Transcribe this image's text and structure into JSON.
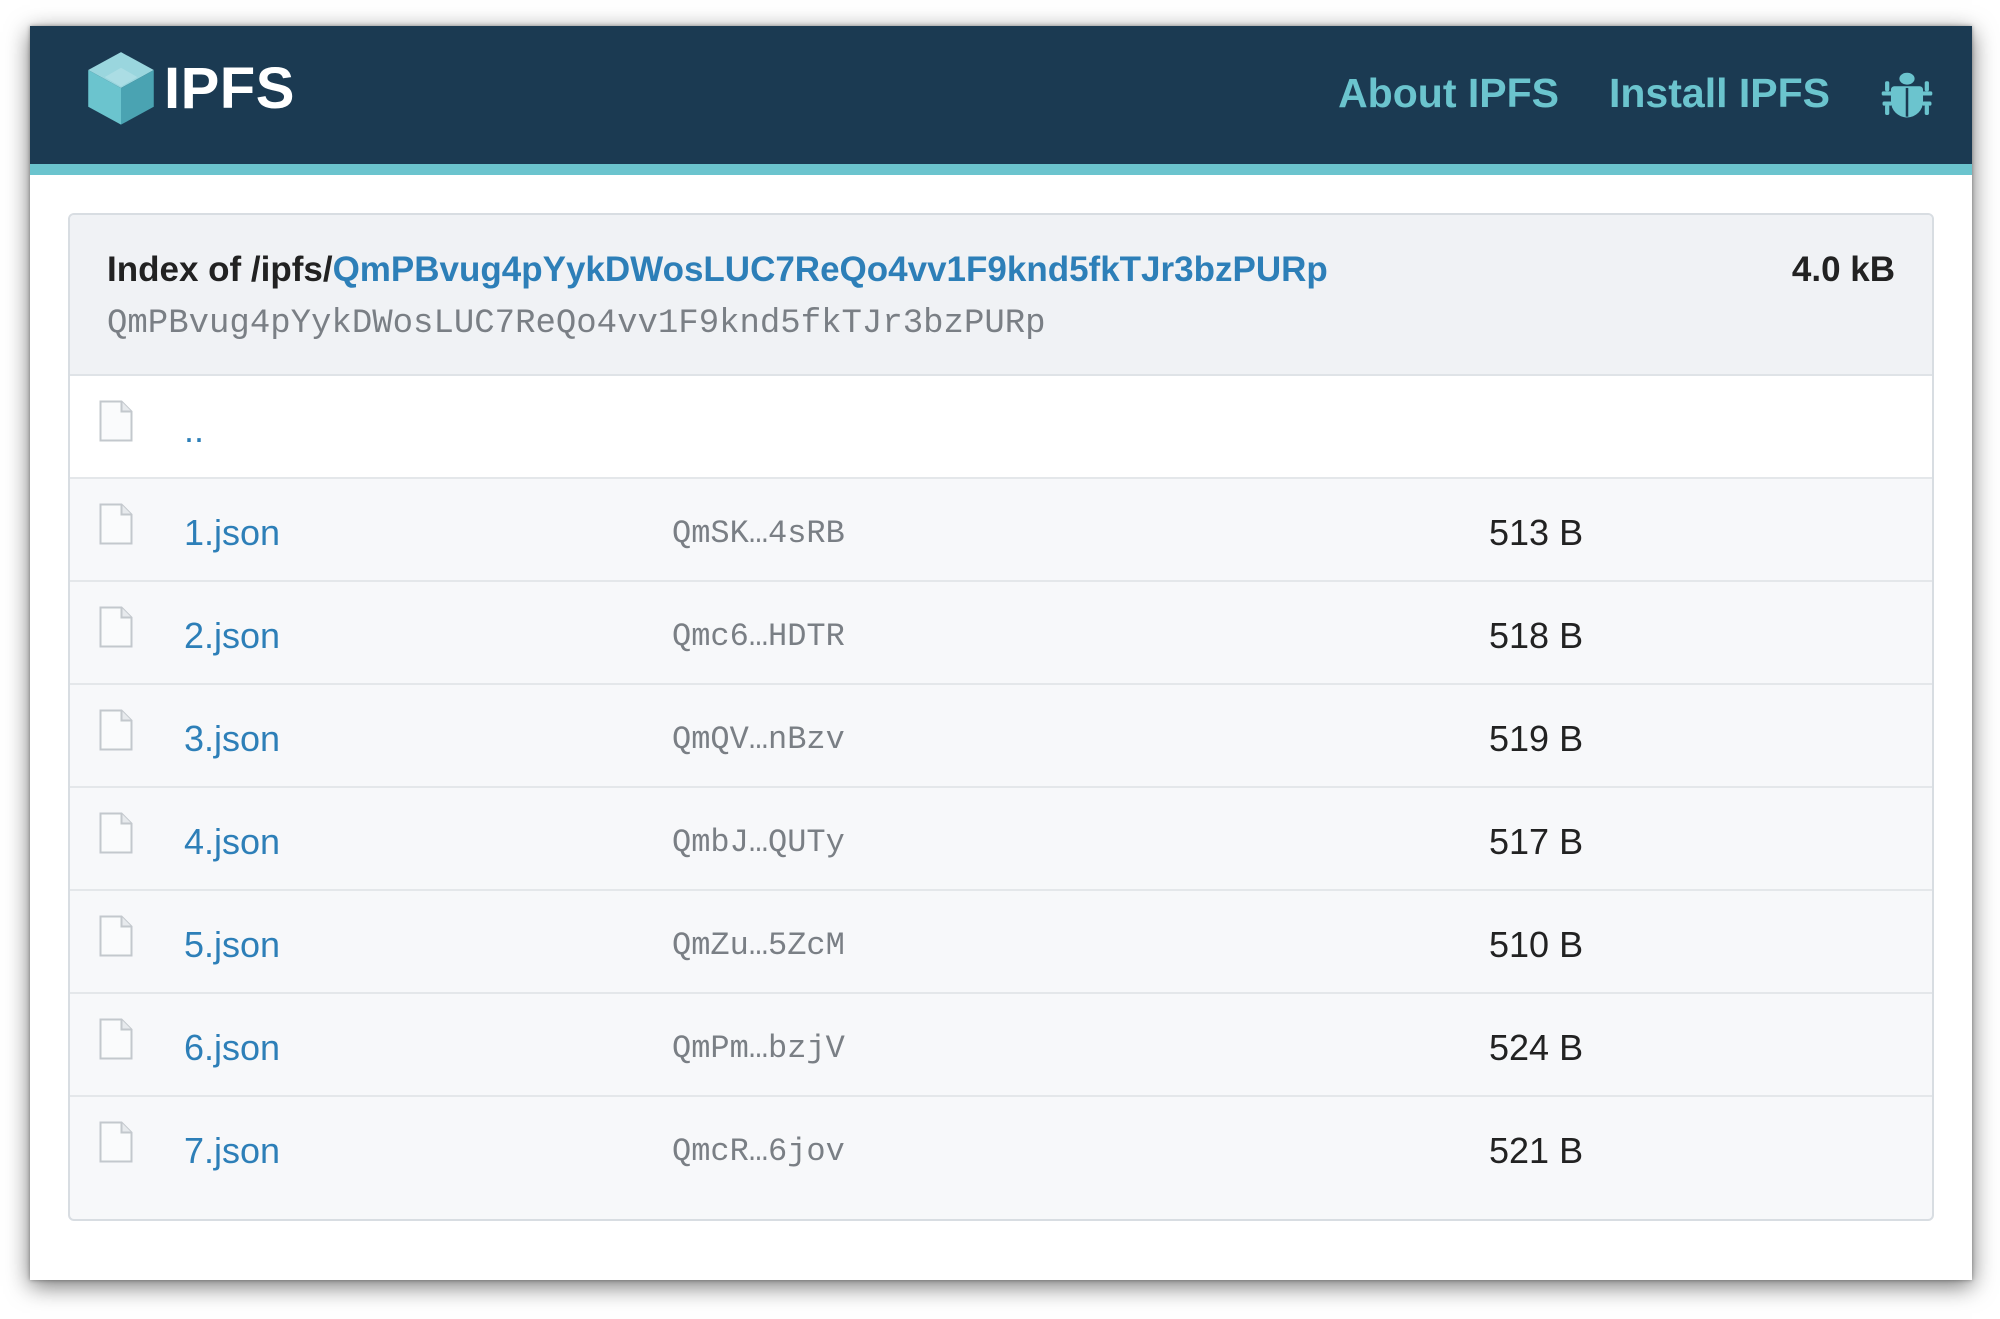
{
  "header": {
    "logo_text": "IPFS",
    "nav": [
      {
        "label": "About IPFS"
      },
      {
        "label": "Install IPFS"
      }
    ],
    "bug_icon": "bug-icon"
  },
  "colors": {
    "header_bg": "#1b3a52",
    "accent": "#6bc4ce",
    "link": "#2d7fb8"
  },
  "index": {
    "prefix": "Index of /ipfs/",
    "hash": "QmPBvug4pYykDWosLUC7ReQo4vv1F9knd5fkTJr3bzPURp",
    "size": "4.0 kB",
    "cid": "QmPBvug4pYykDWosLUC7ReQo4vv1F9knd5fkTJr3bzPURp"
  },
  "parent_link": "..",
  "files": [
    {
      "name": "1.json",
      "cid": "QmSK…4sRB",
      "size": "513 B"
    },
    {
      "name": "2.json",
      "cid": "Qmc6…HDTR",
      "size": "518 B"
    },
    {
      "name": "3.json",
      "cid": "QmQV…nBzv",
      "size": "519 B"
    },
    {
      "name": "4.json",
      "cid": "QmbJ…QUTy",
      "size": "517 B"
    },
    {
      "name": "5.json",
      "cid": "QmZu…5ZcM",
      "size": "510 B"
    },
    {
      "name": "6.json",
      "cid": "QmPm…bzjV",
      "size": "524 B"
    },
    {
      "name": "7.json",
      "cid": "QmcR…6jov",
      "size": "521 B"
    }
  ]
}
